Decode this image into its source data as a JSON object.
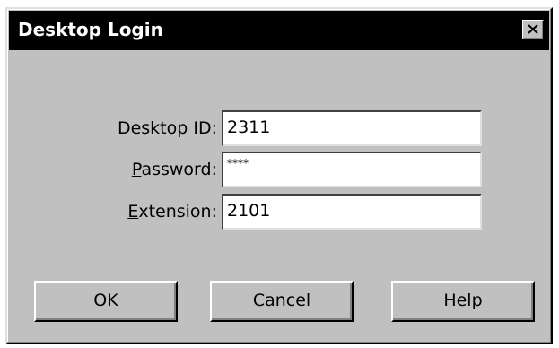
{
  "window": {
    "title": "Desktop Login",
    "close_icon": "close-icon"
  },
  "form": {
    "desktop_id": {
      "label_accel": "D",
      "label_rest": "esktop ID:",
      "value": "2311"
    },
    "password": {
      "label_accel": "P",
      "label_rest": "assword:",
      "value": "****"
    },
    "extension": {
      "label_accel": "E",
      "label_rest": "xtension:",
      "value": "2101"
    }
  },
  "buttons": {
    "ok": "OK",
    "cancel": "Cancel",
    "help": "Help"
  },
  "colors": {
    "face": "#c0c0c0",
    "titlebar": "#000000",
    "title_text": "#ffffff",
    "field_bg": "#ffffff"
  }
}
